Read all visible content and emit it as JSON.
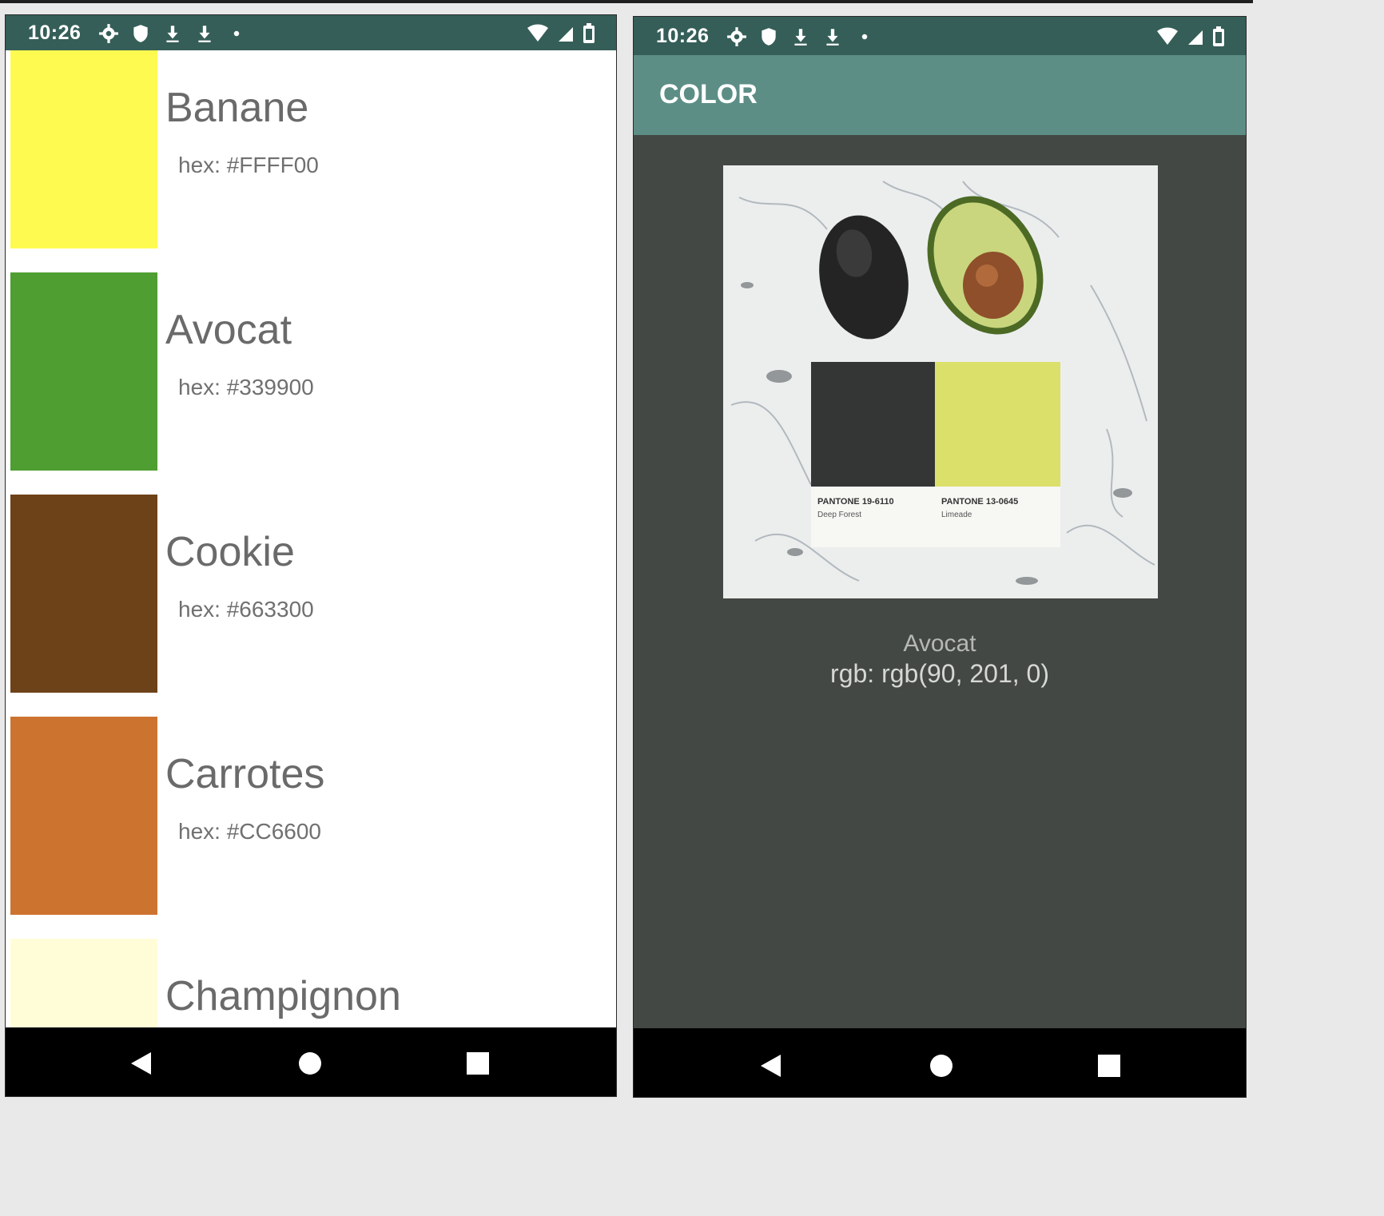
{
  "status_bar": {
    "time": "10:26"
  },
  "list_screen": {
    "items": [
      {
        "name": "Banane",
        "hex_label": "hex: #FFFF00",
        "swatch_color": "#FFFA50"
      },
      {
        "name": "Avocat",
        "hex_label": "hex: #339900",
        "swatch_color": "#4F9E31"
      },
      {
        "name": "Cookie",
        "hex_label": "hex: #663300",
        "swatch_color": "#6E4219"
      },
      {
        "name": "Carrotes",
        "hex_label": "hex: #CC6600",
        "swatch_color": "#CD7330"
      },
      {
        "name": "Champignon",
        "hex_label": "",
        "swatch_color": "#FFFDD8"
      }
    ]
  },
  "detail_screen": {
    "appbar_title": "COLOR",
    "selected_name": "Avocat",
    "rgb_label": "rgb:  rgb(90, 201, 0)",
    "photo_card_left": {
      "code": "PANTONE 19-6110",
      "name": "Deep Forest"
    },
    "photo_card_right": {
      "code": "PANTONE 13-0645",
      "name": "Limeade"
    }
  },
  "colors": {
    "status_bar": "#355e58",
    "app_bar": "#5c8e86",
    "detail_bg": "#444844",
    "nav_bar": "#000000"
  },
  "icons": [
    "settings-icon",
    "shield-icon",
    "download-icon",
    "dot-icon",
    "wifi-icon",
    "signal-icon",
    "battery-icon",
    "back-icon",
    "home-icon",
    "recents-icon"
  ]
}
